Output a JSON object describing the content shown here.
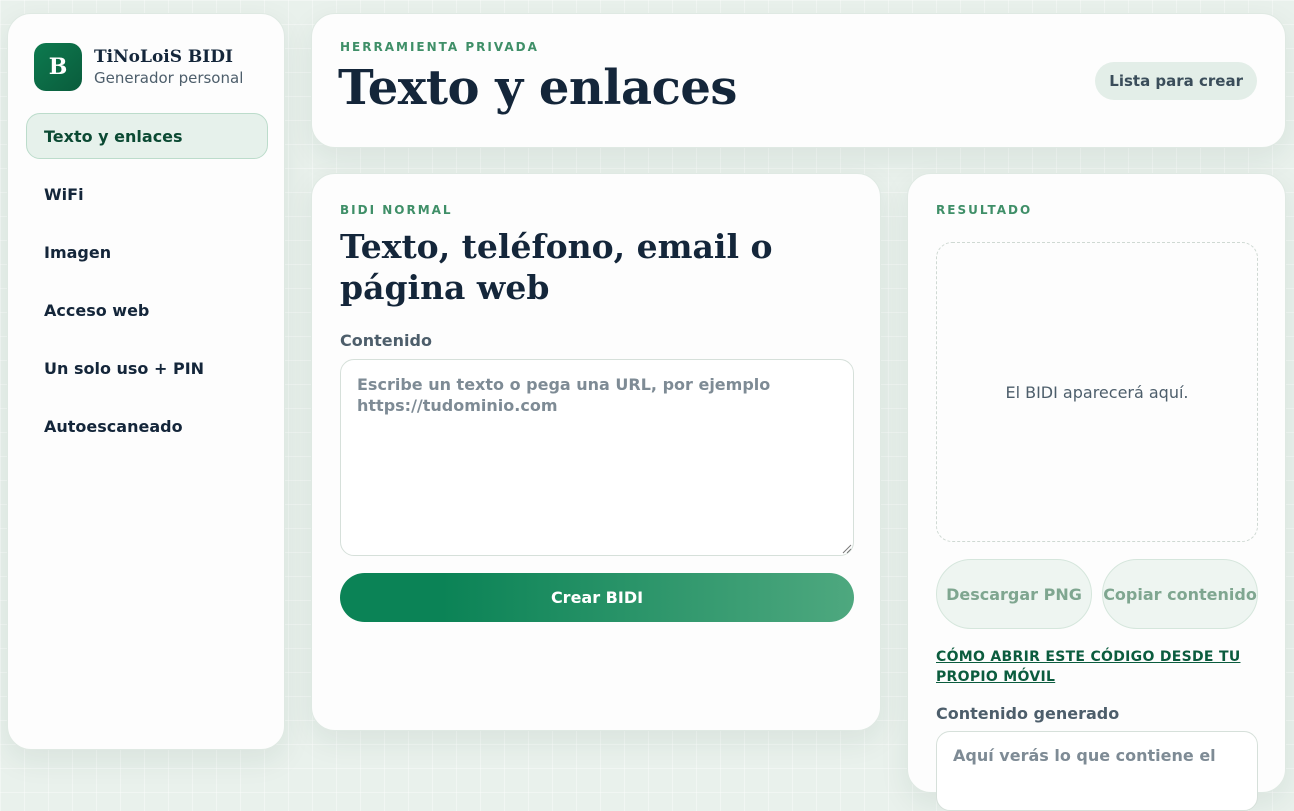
{
  "brand": {
    "logo_letter": "B",
    "name": "TiNoLoiS BIDI",
    "subtitle": "Generador personal"
  },
  "nav": {
    "items": [
      {
        "label": "Texto y enlaces",
        "active": true
      },
      {
        "label": "WiFi"
      },
      {
        "label": "Imagen"
      },
      {
        "label": "Acceso web"
      },
      {
        "label": "Un solo uso + PIN"
      },
      {
        "label": "Autoescaneado"
      }
    ]
  },
  "header": {
    "eyebrow": "HERRAMIENTA PRIVADA",
    "title": "Texto y enlaces",
    "status": "Lista para crear"
  },
  "form": {
    "eyebrow": "BIDI NORMAL",
    "title": "Texto, teléfono, email o página web",
    "content_label": "Contenido",
    "content_value": "",
    "content_placeholder": "Escribe un texto o pega una URL, por ejemplo https://tudominio.com",
    "submit_label": "Crear BIDI"
  },
  "result": {
    "eyebrow": "RESULTADO",
    "placeholder": "El BIDI aparecerá aquí.",
    "download_label": "Descargar PNG",
    "copy_label": "Copiar contenido",
    "help_link": "CÓMO ABRIR ESTE CÓDIGO DESDE TU PROPIO MÓVIL",
    "generated_label": "Contenido generado",
    "generated_placeholder": "Aquí verás lo que contiene el"
  },
  "colors": {
    "accent": "#0b8356",
    "accent_light": "#4ea87f",
    "text": "#14263a",
    "eyebrow": "#3f8f68"
  }
}
